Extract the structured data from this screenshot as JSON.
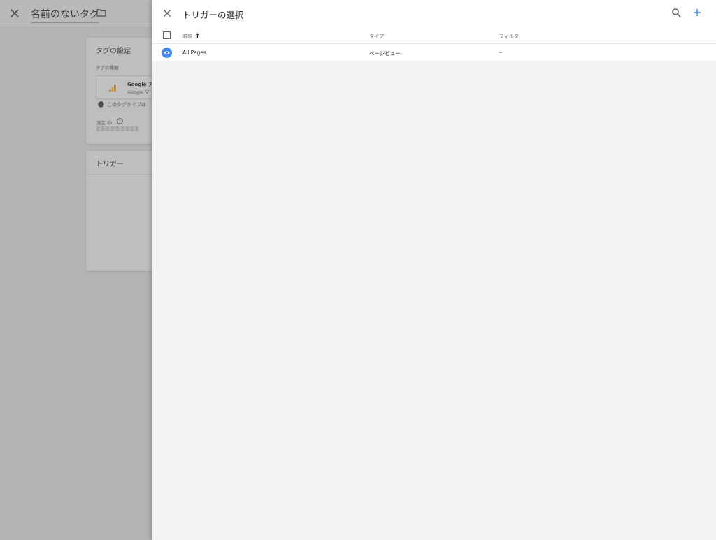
{
  "editor": {
    "title": "名前のないタグ",
    "config_card": {
      "title": "タグの設定",
      "type_label": "タグの種類",
      "type_name": "Google ア",
      "type_sub": "Google マ",
      "info_text": "このタグタイプは",
      "measurement_id_label": "測定 ID"
    },
    "trigger_card": {
      "title": "トリガー"
    }
  },
  "panel": {
    "title": "トリガーの選択",
    "columns": {
      "name": "名前",
      "type": "タイプ",
      "filter": "フィルタ"
    },
    "rows": [
      {
        "name": "All Pages",
        "type": "ページビュー",
        "filter": "–"
      }
    ]
  },
  "colors": {
    "accent": "#4285f4",
    "overlay": "#b3b4b6"
  }
}
